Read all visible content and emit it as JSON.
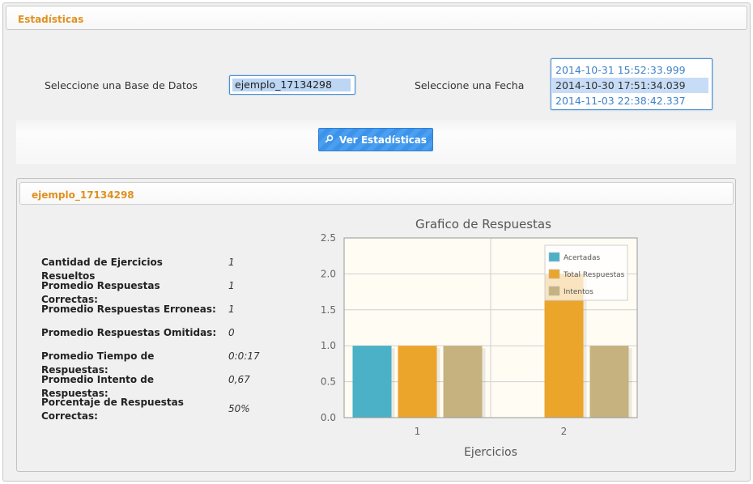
{
  "header": {
    "title": "Estadísticas"
  },
  "form": {
    "db_label": "Seleccione una Base de Datos",
    "db_value": "ejemplo_17134298",
    "date_label": "Seleccione una Fecha",
    "dates": [
      {
        "text": "2014-10-31 15:52:33.999",
        "selected": false
      },
      {
        "text": "2014-10-30 17:51:34.039",
        "selected": true
      },
      {
        "text": "2014-11-03 22:38:42.337",
        "selected": false
      }
    ],
    "button_label": "Ver Estadísticas",
    "button_icon": "search-icon"
  },
  "results": {
    "title": "ejemplo_17134298",
    "stats": [
      {
        "label": "Cantidad de Ejercicios Resueltos",
        "value": "1"
      },
      {
        "label": "Promedio Respuestas Correctas:",
        "value": "1"
      },
      {
        "label": "Promedio Respuestas Erroneas:",
        "value": "1"
      },
      {
        "label": "Promedio Respuestas Omitidas:",
        "value": "0"
      },
      {
        "label": "Promedio Tiempo de Respuestas:",
        "value": "0:0:17"
      },
      {
        "label": "Promedio Intento de Respuestas:",
        "value": "0,67"
      },
      {
        "label": "Porcentaje de Respuestas Correctas:",
        "value": "50%"
      }
    ]
  },
  "colors": {
    "accent": "#e0901f",
    "button": "#3d93ea",
    "series_acertadas": "#4ab1c7",
    "series_total": "#eba52b",
    "series_intentos": "#c5b27e"
  },
  "chart_data": {
    "type": "bar",
    "title": "Grafico de Respuestas",
    "xlabel": "Ejercicios",
    "ylabel": "",
    "categories": [
      "1",
      "2"
    ],
    "ylim": [
      0,
      2.5
    ],
    "yticks": [
      "0.0",
      "0.5",
      "1.0",
      "1.5",
      "2.0",
      "2.5"
    ],
    "grid": true,
    "legend_position": "top-right",
    "series": [
      {
        "name": "Acertadas",
        "values": [
          1,
          0
        ],
        "color": "#4ab1c7"
      },
      {
        "name": "Total Respuestas",
        "values": [
          1,
          2
        ],
        "color": "#eba52b"
      },
      {
        "name": "Intentos",
        "values": [
          1,
          1
        ],
        "color": "#c5b27e"
      }
    ]
  }
}
